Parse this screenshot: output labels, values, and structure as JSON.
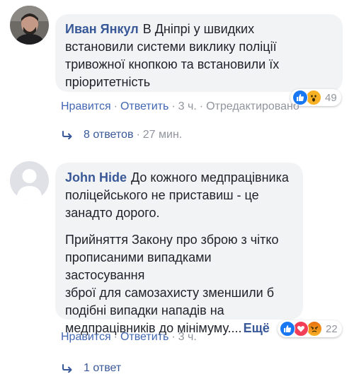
{
  "comments": [
    {
      "author": "Иван Янкул",
      "text_lines": [
        "В Дніпрі у швидких",
        "встановили системи виклику поліції",
        "тривожної кнопкою та встановили їх",
        "пріоритетність"
      ],
      "reactions": [
        "like",
        "wow"
      ],
      "reaction_count": "49",
      "actions": {
        "like": "Нравится",
        "reply": "Ответить",
        "time": "3 ч.",
        "edited": "Отредактировано"
      },
      "replies": {
        "label": "8 ответов",
        "time": "27 мин."
      }
    },
    {
      "author": "John Hide",
      "text_lines": [
        "До кожного медпрацівника",
        "поліцейського не приставиш - це",
        "занадто дорого."
      ],
      "text2_lines": [
        "Прийняття Закону про зброю з чітко",
        "прописаними випадками застосування",
        "зброї для самозахисту зменшили б",
        "подібні випадки нападів на",
        "медпрацівників до мінімуму...."
      ],
      "more": "Ещё",
      "reactions": [
        "like",
        "love",
        "angry"
      ],
      "reaction_count": "22",
      "actions": {
        "like": "Нравится",
        "reply": "Ответить",
        "time": "3 ч."
      },
      "replies": {
        "label": "1 ответ"
      }
    }
  ],
  "colors": {
    "link": "#385898",
    "bubble": "#f2f3f5",
    "meta": "#90949c",
    "like": "#1877f2",
    "love": "#f33e58",
    "wow": "#f7b125"
  }
}
